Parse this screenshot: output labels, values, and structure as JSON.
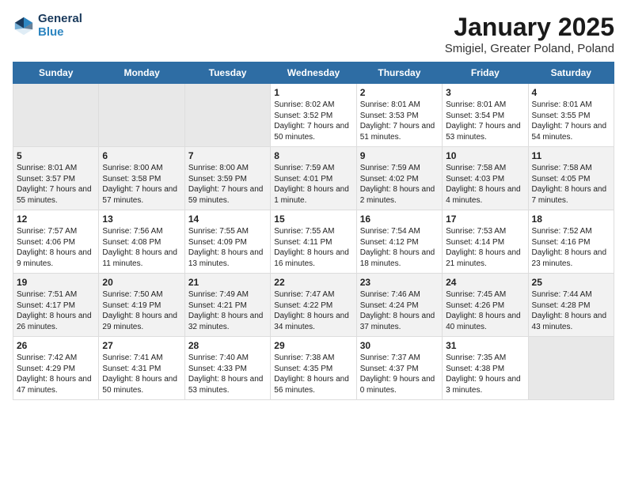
{
  "logo": {
    "line1": "General",
    "line2": "Blue"
  },
  "title": "January 2025",
  "subtitle": "Smigiel, Greater Poland, Poland",
  "days_of_week": [
    "Sunday",
    "Monday",
    "Tuesday",
    "Wednesday",
    "Thursday",
    "Friday",
    "Saturday"
  ],
  "weeks": [
    [
      {
        "day": "",
        "empty": true
      },
      {
        "day": "",
        "empty": true
      },
      {
        "day": "",
        "empty": true
      },
      {
        "day": "1",
        "sunrise": "8:02 AM",
        "sunset": "3:52 PM",
        "daylight": "7 hours and 50 minutes."
      },
      {
        "day": "2",
        "sunrise": "8:01 AM",
        "sunset": "3:53 PM",
        "daylight": "7 hours and 51 minutes."
      },
      {
        "day": "3",
        "sunrise": "8:01 AM",
        "sunset": "3:54 PM",
        "daylight": "7 hours and 53 minutes."
      },
      {
        "day": "4",
        "sunrise": "8:01 AM",
        "sunset": "3:55 PM",
        "daylight": "7 hours and 54 minutes."
      }
    ],
    [
      {
        "day": "5",
        "sunrise": "8:01 AM",
        "sunset": "3:57 PM",
        "daylight": "7 hours and 55 minutes."
      },
      {
        "day": "6",
        "sunrise": "8:00 AM",
        "sunset": "3:58 PM",
        "daylight": "7 hours and 57 minutes."
      },
      {
        "day": "7",
        "sunrise": "8:00 AM",
        "sunset": "3:59 PM",
        "daylight": "7 hours and 59 minutes."
      },
      {
        "day": "8",
        "sunrise": "7:59 AM",
        "sunset": "4:01 PM",
        "daylight": "8 hours and 1 minute."
      },
      {
        "day": "9",
        "sunrise": "7:59 AM",
        "sunset": "4:02 PM",
        "daylight": "8 hours and 2 minutes."
      },
      {
        "day": "10",
        "sunrise": "7:58 AM",
        "sunset": "4:03 PM",
        "daylight": "8 hours and 4 minutes."
      },
      {
        "day": "11",
        "sunrise": "7:58 AM",
        "sunset": "4:05 PM",
        "daylight": "8 hours and 7 minutes."
      }
    ],
    [
      {
        "day": "12",
        "sunrise": "7:57 AM",
        "sunset": "4:06 PM",
        "daylight": "8 hours and 9 minutes."
      },
      {
        "day": "13",
        "sunrise": "7:56 AM",
        "sunset": "4:08 PM",
        "daylight": "8 hours and 11 minutes."
      },
      {
        "day": "14",
        "sunrise": "7:55 AM",
        "sunset": "4:09 PM",
        "daylight": "8 hours and 13 minutes."
      },
      {
        "day": "15",
        "sunrise": "7:55 AM",
        "sunset": "4:11 PM",
        "daylight": "8 hours and 16 minutes."
      },
      {
        "day": "16",
        "sunrise": "7:54 AM",
        "sunset": "4:12 PM",
        "daylight": "8 hours and 18 minutes."
      },
      {
        "day": "17",
        "sunrise": "7:53 AM",
        "sunset": "4:14 PM",
        "daylight": "8 hours and 21 minutes."
      },
      {
        "day": "18",
        "sunrise": "7:52 AM",
        "sunset": "4:16 PM",
        "daylight": "8 hours and 23 minutes."
      }
    ],
    [
      {
        "day": "19",
        "sunrise": "7:51 AM",
        "sunset": "4:17 PM",
        "daylight": "8 hours and 26 minutes."
      },
      {
        "day": "20",
        "sunrise": "7:50 AM",
        "sunset": "4:19 PM",
        "daylight": "8 hours and 29 minutes."
      },
      {
        "day": "21",
        "sunrise": "7:49 AM",
        "sunset": "4:21 PM",
        "daylight": "8 hours and 32 minutes."
      },
      {
        "day": "22",
        "sunrise": "7:47 AM",
        "sunset": "4:22 PM",
        "daylight": "8 hours and 34 minutes."
      },
      {
        "day": "23",
        "sunrise": "7:46 AM",
        "sunset": "4:24 PM",
        "daylight": "8 hours and 37 minutes."
      },
      {
        "day": "24",
        "sunrise": "7:45 AM",
        "sunset": "4:26 PM",
        "daylight": "8 hours and 40 minutes."
      },
      {
        "day": "25",
        "sunrise": "7:44 AM",
        "sunset": "4:28 PM",
        "daylight": "8 hours and 43 minutes."
      }
    ],
    [
      {
        "day": "26",
        "sunrise": "7:42 AM",
        "sunset": "4:29 PM",
        "daylight": "8 hours and 47 minutes."
      },
      {
        "day": "27",
        "sunrise": "7:41 AM",
        "sunset": "4:31 PM",
        "daylight": "8 hours and 50 minutes."
      },
      {
        "day": "28",
        "sunrise": "7:40 AM",
        "sunset": "4:33 PM",
        "daylight": "8 hours and 53 minutes."
      },
      {
        "day": "29",
        "sunrise": "7:38 AM",
        "sunset": "4:35 PM",
        "daylight": "8 hours and 56 minutes."
      },
      {
        "day": "30",
        "sunrise": "7:37 AM",
        "sunset": "4:37 PM",
        "daylight": "9 hours and 0 minutes."
      },
      {
        "day": "31",
        "sunrise": "7:35 AM",
        "sunset": "4:38 PM",
        "daylight": "9 hours and 3 minutes."
      },
      {
        "day": "",
        "empty": true
      }
    ]
  ]
}
